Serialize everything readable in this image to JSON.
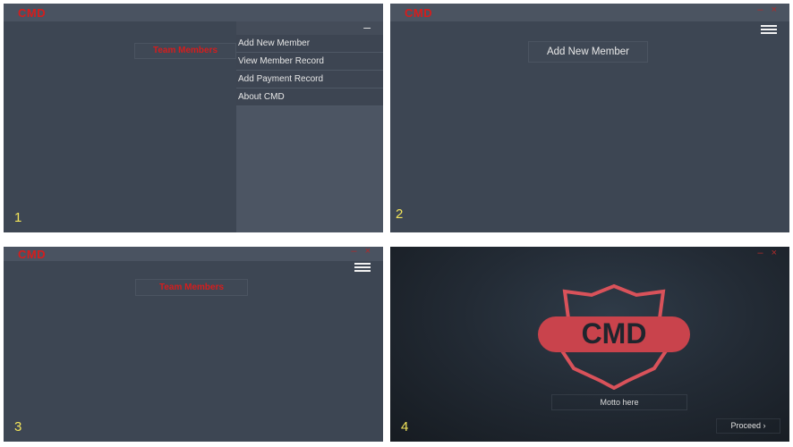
{
  "app": {
    "title": "CMD",
    "win_minimize": "–",
    "win_close": "×"
  },
  "panel1": {
    "step": "1",
    "team_button": "Team Members",
    "drawer_collapse": "–",
    "menu": [
      {
        "label": "Add New Member"
      },
      {
        "label": "View Member Record"
      },
      {
        "label": "Add Payment Record"
      },
      {
        "label": "About CMD"
      }
    ]
  },
  "panel2": {
    "step": "2",
    "add_button": "Add New Member"
  },
  "panel3": {
    "step": "3",
    "team_button": "Team Members"
  },
  "panel4": {
    "step": "4",
    "logo_text": "CMD",
    "motto": "Motto here",
    "proceed": "Proceed ›"
  },
  "colors": {
    "brand_red": "#d51d1d",
    "step_yellow": "#f3e55a",
    "panel_bg": "#3d4653"
  }
}
